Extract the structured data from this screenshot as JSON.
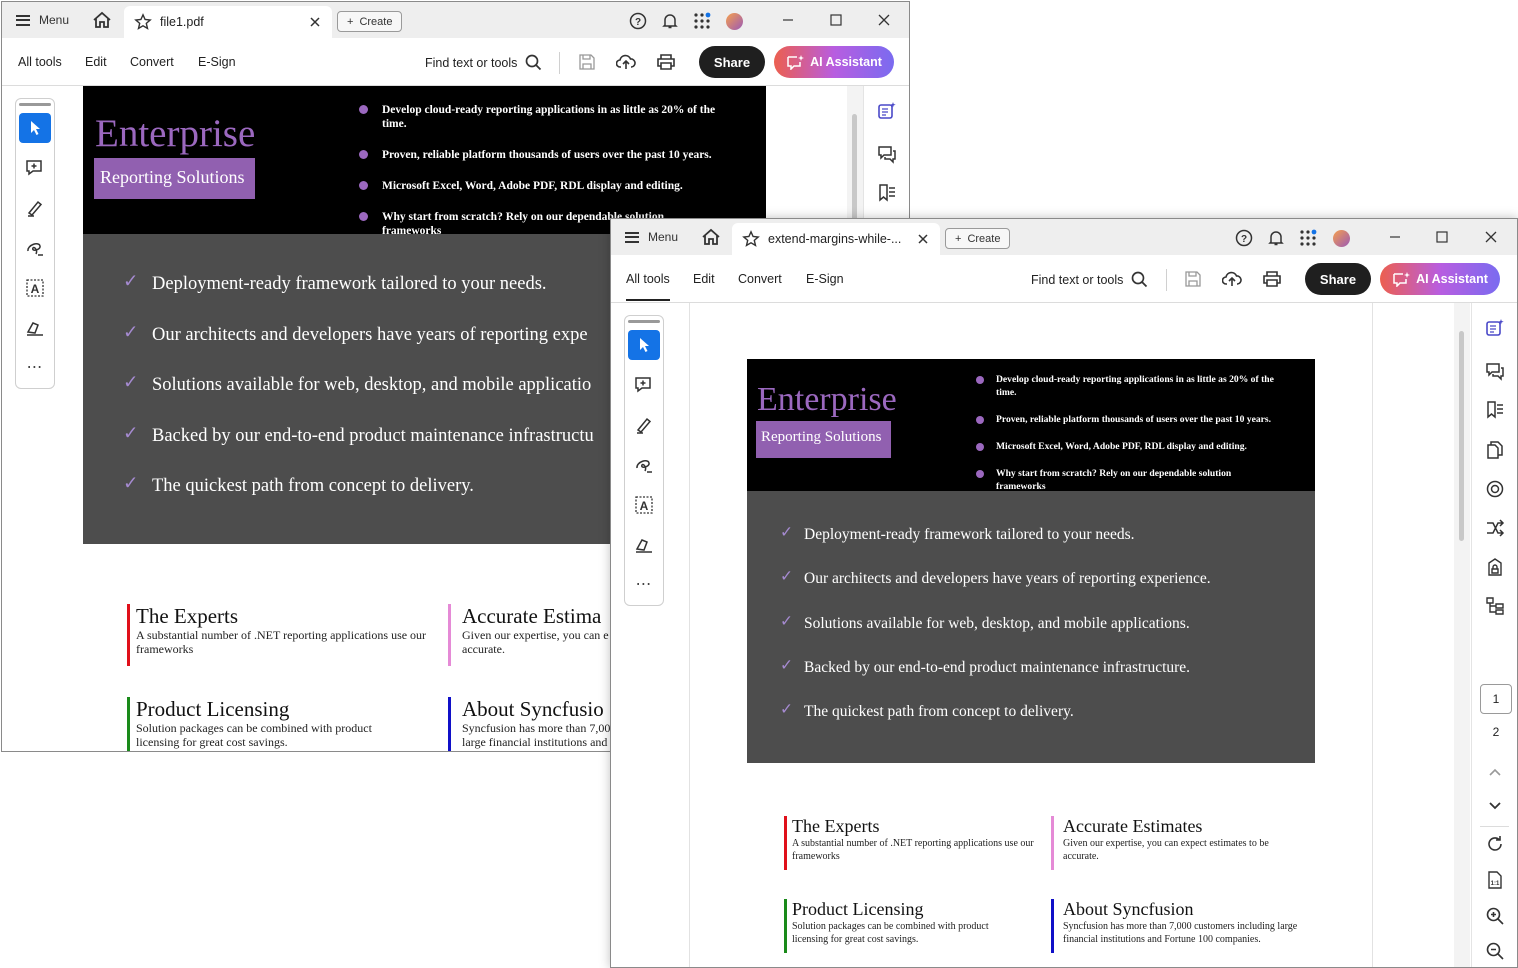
{
  "app": {
    "menu_label": "Menu",
    "create_label": "Create",
    "menus": [
      "All tools",
      "Edit",
      "Convert",
      "E-Sign"
    ],
    "find_label": "Find text or tools",
    "share_label": "Share",
    "ai_label": "AI Assistant",
    "accent": "#1473e6"
  },
  "window1": {
    "tab_title": "file1.pdf"
  },
  "window2": {
    "tab_title": "extend-margins-while-...",
    "page_current": "1",
    "page_total": "2"
  },
  "pdf": {
    "title": "Enterprise",
    "subtitle": "Reporting Solutions",
    "bullets": [
      "Develop cloud-ready reporting applications in as little as 20% of the time.",
      "Proven, reliable platform thousands of users over the past 10 years.",
      "Microsoft Excel, Word, Adobe PDF, RDL display and editing.",
      "Why start from scratch? Rely on our dependable solution frameworks"
    ],
    "check_mark": "✓",
    "checks": [
      "Deployment-ready framework tailored to your needs.",
      "Our architects and developers have years of reporting experience.",
      "Solutions available for web, desktop, and mobile applications.",
      "Backed by our end-to-end product maintenance infrastructure.",
      "The quickest path from concept to delivery."
    ],
    "features": [
      {
        "title": "The Experts",
        "body": "A substantial number of .NET reporting applications use our frameworks",
        "color": "#e0101a"
      },
      {
        "title": "Accurate Estimates",
        "body": "Given our expertise, you can expect estimates to be accurate.",
        "color": "#e58ad6"
      },
      {
        "title": "Product Licensing",
        "body": "Solution packages can be combined with product licensing for great cost savings.",
        "color": "#1a8a1a"
      },
      {
        "title": "About Syncfusion",
        "body": "Syncfusion has more than 7,000 customers including large financial institutions and Fortune 100 companies.",
        "color": "#1010c8"
      }
    ],
    "w1_features": [
      {
        "title": "The Experts",
        "body": "A substantial number of .NET reporting applications use our frameworks"
      },
      {
        "title": "Accurate Estima",
        "body": "Given our expertise, you can e accurate."
      },
      {
        "title": "Product Licensing",
        "body": "Solution packages can be combined with product licensing for great cost savings."
      },
      {
        "title": "About Syncfusio",
        "body": "Syncfusion has more than 7,00 large financial institutions and"
      }
    ],
    "w1_checks": [
      "Deployment-ready framework tailored to your needs.",
      "Our architects and developers have years of reporting expe",
      "Solutions available for web, desktop, and mobile applicatio",
      "Backed by our end-to-end product maintenance infrastructu",
      "The quickest path from concept to delivery."
    ]
  }
}
